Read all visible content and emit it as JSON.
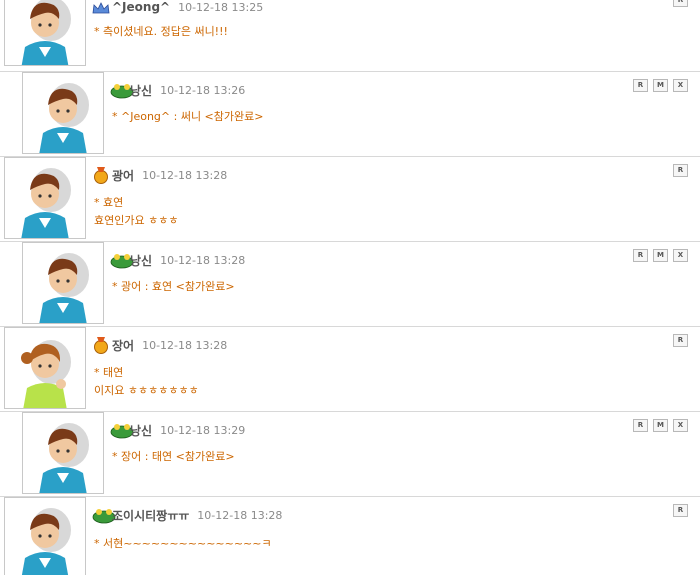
{
  "comments": [
    {
      "nick": "^Jeong^",
      "badge": "crown",
      "date": "10-12-18 13:25",
      "lines": [
        "* 측이셨네요. 정답은 써니!!!"
      ],
      "buttons": [
        "R"
      ]
    },
    {
      "nick": "낭신",
      "badge": "frog",
      "date": "10-12-18 13:26",
      "lines": [
        "* ^Jeong^ : 써니 <참가완료>"
      ],
      "buttons": [
        "R",
        "M",
        "X"
      ]
    },
    {
      "nick": "광어",
      "badge": "medal",
      "date": "10-12-18 13:28",
      "lines": [
        "* 효연",
        "효연인가요 ㅎㅎㅎ"
      ],
      "buttons": [
        "R"
      ]
    },
    {
      "nick": "낭신",
      "badge": "frog",
      "date": "10-12-18 13:28",
      "lines": [
        "* 광어 : 효연 <참가완료>"
      ],
      "buttons": [
        "R",
        "M",
        "X"
      ]
    },
    {
      "nick": "장어",
      "badge": "medal",
      "date": "10-12-18 13:28",
      "lines": [
        "* 태연",
        "이지요 ㅎㅎㅎㅎㅎㅎㅎ"
      ],
      "buttons": [
        "R"
      ]
    },
    {
      "nick": "낭신",
      "badge": "frog",
      "date": "10-12-18 13:29",
      "lines": [
        "* 장어 : 태연 <참가완료>"
      ],
      "buttons": [
        "R",
        "M",
        "X"
      ]
    },
    {
      "nick": "조이시티짱ㅠㅠ",
      "badge": "frog",
      "date": "10-12-18 13:28",
      "lines": [
        "* 서현~~~~~~~~~~~~~~~ㅋ"
      ],
      "buttons": [
        "R"
      ]
    }
  ]
}
